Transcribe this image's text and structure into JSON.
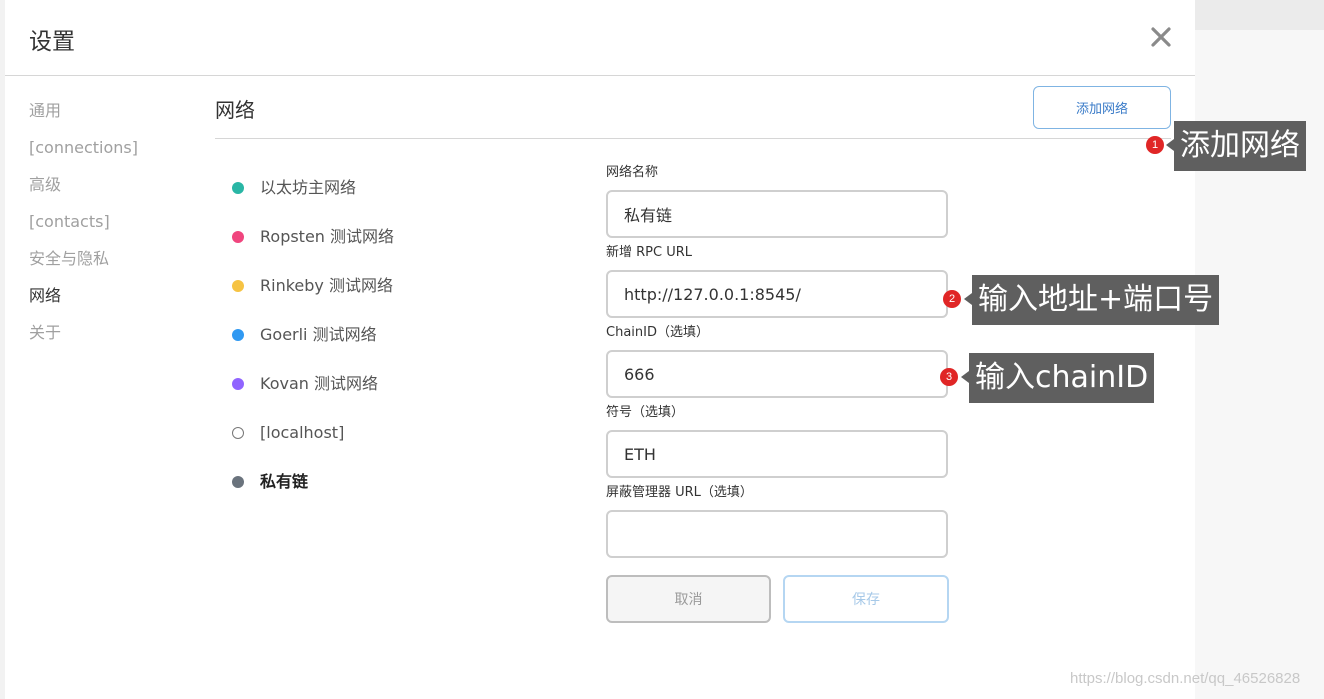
{
  "modal": {
    "title": "设置",
    "close_icon": "close-icon"
  },
  "sidebar": {
    "items": [
      {
        "label": "通用",
        "active": false
      },
      {
        "label": "[connections]",
        "active": false
      },
      {
        "label": "高级",
        "active": false
      },
      {
        "label": "[contacts]",
        "active": false
      },
      {
        "label": "安全与隐私",
        "active": false
      },
      {
        "label": "网络",
        "active": true
      },
      {
        "label": "关于",
        "active": false
      }
    ]
  },
  "content": {
    "title": "网络",
    "add_network_label": "添加网络"
  },
  "networks": [
    {
      "label": "以太坊主网络",
      "color": "#29b6a5"
    },
    {
      "label": "Ropsten 测试网络",
      "color": "#f0457e"
    },
    {
      "label": "Rinkeby 测试网络",
      "color": "#f6c343"
    },
    {
      "label": "Goerli 测试网络",
      "color": "#3099f2"
    },
    {
      "label": "Kovan 测试网络",
      "color": "#9064ff"
    },
    {
      "label": "[localhost]",
      "color": "#ffffff"
    },
    {
      "label": "私有链",
      "color": "#6a737d"
    }
  ],
  "form": {
    "network_name_label": "网络名称",
    "network_name_value": "私有链",
    "rpc_url_label": "新增 RPC URL",
    "rpc_url_value": "http://127.0.0.1:8545/",
    "chain_id_label": "ChainID（选填）",
    "chain_id_value": "666",
    "symbol_label": "符号（选填）",
    "symbol_value": "ETH",
    "explorer_label": "屏蔽管理器 URL（选填）",
    "explorer_value": "",
    "cancel_label": "取消",
    "save_label": "保存"
  },
  "annotations": [
    {
      "number": "1",
      "text": "添加网络"
    },
    {
      "number": "2",
      "text": "输入地址+端口号"
    },
    {
      "number": "3",
      "text": "输入chainID"
    }
  ],
  "watermark": "https://blog.csdn.net/qq_46526828"
}
